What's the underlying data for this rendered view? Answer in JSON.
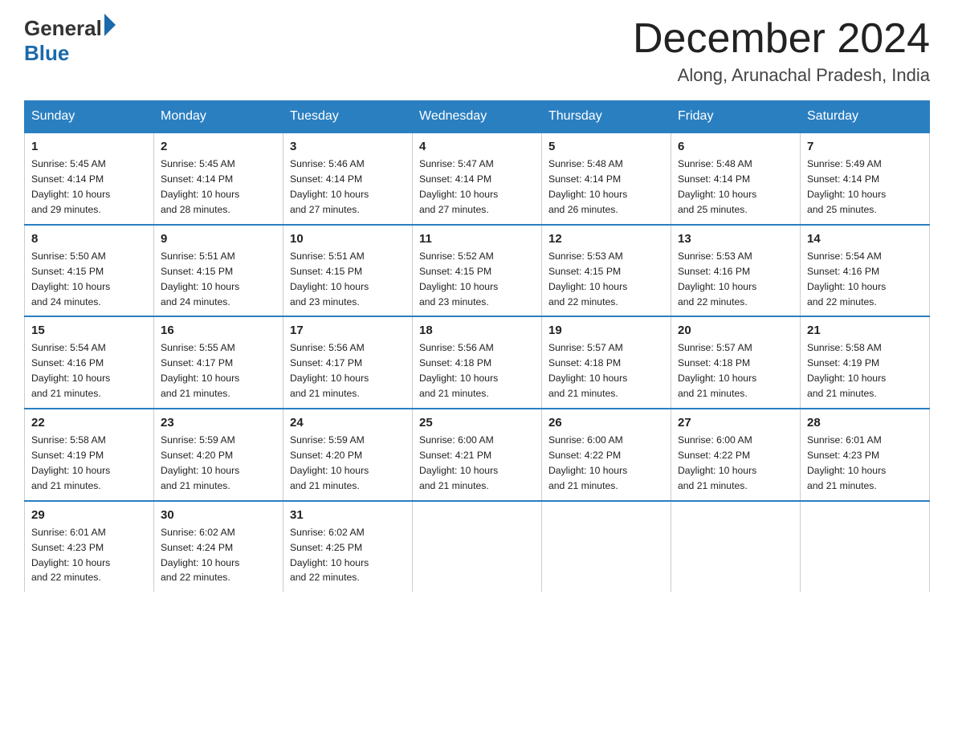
{
  "header": {
    "logo_general": "General",
    "logo_blue": "Blue",
    "month_title": "December 2024",
    "location": "Along, Arunachal Pradesh, India"
  },
  "days_of_week": [
    "Sunday",
    "Monday",
    "Tuesday",
    "Wednesday",
    "Thursday",
    "Friday",
    "Saturday"
  ],
  "weeks": [
    [
      {
        "day": "1",
        "sunrise": "5:45 AM",
        "sunset": "4:14 PM",
        "daylight": "10 hours and 29 minutes."
      },
      {
        "day": "2",
        "sunrise": "5:45 AM",
        "sunset": "4:14 PM",
        "daylight": "10 hours and 28 minutes."
      },
      {
        "day": "3",
        "sunrise": "5:46 AM",
        "sunset": "4:14 PM",
        "daylight": "10 hours and 27 minutes."
      },
      {
        "day": "4",
        "sunrise": "5:47 AM",
        "sunset": "4:14 PM",
        "daylight": "10 hours and 27 minutes."
      },
      {
        "day": "5",
        "sunrise": "5:48 AM",
        "sunset": "4:14 PM",
        "daylight": "10 hours and 26 minutes."
      },
      {
        "day": "6",
        "sunrise": "5:48 AM",
        "sunset": "4:14 PM",
        "daylight": "10 hours and 25 minutes."
      },
      {
        "day": "7",
        "sunrise": "5:49 AM",
        "sunset": "4:14 PM",
        "daylight": "10 hours and 25 minutes."
      }
    ],
    [
      {
        "day": "8",
        "sunrise": "5:50 AM",
        "sunset": "4:15 PM",
        "daylight": "10 hours and 24 minutes."
      },
      {
        "day": "9",
        "sunrise": "5:51 AM",
        "sunset": "4:15 PM",
        "daylight": "10 hours and 24 minutes."
      },
      {
        "day": "10",
        "sunrise": "5:51 AM",
        "sunset": "4:15 PM",
        "daylight": "10 hours and 23 minutes."
      },
      {
        "day": "11",
        "sunrise": "5:52 AM",
        "sunset": "4:15 PM",
        "daylight": "10 hours and 23 minutes."
      },
      {
        "day": "12",
        "sunrise": "5:53 AM",
        "sunset": "4:15 PM",
        "daylight": "10 hours and 22 minutes."
      },
      {
        "day": "13",
        "sunrise": "5:53 AM",
        "sunset": "4:16 PM",
        "daylight": "10 hours and 22 minutes."
      },
      {
        "day": "14",
        "sunrise": "5:54 AM",
        "sunset": "4:16 PM",
        "daylight": "10 hours and 22 minutes."
      }
    ],
    [
      {
        "day": "15",
        "sunrise": "5:54 AM",
        "sunset": "4:16 PM",
        "daylight": "10 hours and 21 minutes."
      },
      {
        "day": "16",
        "sunrise": "5:55 AM",
        "sunset": "4:17 PM",
        "daylight": "10 hours and 21 minutes."
      },
      {
        "day": "17",
        "sunrise": "5:56 AM",
        "sunset": "4:17 PM",
        "daylight": "10 hours and 21 minutes."
      },
      {
        "day": "18",
        "sunrise": "5:56 AM",
        "sunset": "4:18 PM",
        "daylight": "10 hours and 21 minutes."
      },
      {
        "day": "19",
        "sunrise": "5:57 AM",
        "sunset": "4:18 PM",
        "daylight": "10 hours and 21 minutes."
      },
      {
        "day": "20",
        "sunrise": "5:57 AM",
        "sunset": "4:18 PM",
        "daylight": "10 hours and 21 minutes."
      },
      {
        "day": "21",
        "sunrise": "5:58 AM",
        "sunset": "4:19 PM",
        "daylight": "10 hours and 21 minutes."
      }
    ],
    [
      {
        "day": "22",
        "sunrise": "5:58 AM",
        "sunset": "4:19 PM",
        "daylight": "10 hours and 21 minutes."
      },
      {
        "day": "23",
        "sunrise": "5:59 AM",
        "sunset": "4:20 PM",
        "daylight": "10 hours and 21 minutes."
      },
      {
        "day": "24",
        "sunrise": "5:59 AM",
        "sunset": "4:20 PM",
        "daylight": "10 hours and 21 minutes."
      },
      {
        "day": "25",
        "sunrise": "6:00 AM",
        "sunset": "4:21 PM",
        "daylight": "10 hours and 21 minutes."
      },
      {
        "day": "26",
        "sunrise": "6:00 AM",
        "sunset": "4:22 PM",
        "daylight": "10 hours and 21 minutes."
      },
      {
        "day": "27",
        "sunrise": "6:00 AM",
        "sunset": "4:22 PM",
        "daylight": "10 hours and 21 minutes."
      },
      {
        "day": "28",
        "sunrise": "6:01 AM",
        "sunset": "4:23 PM",
        "daylight": "10 hours and 21 minutes."
      }
    ],
    [
      {
        "day": "29",
        "sunrise": "6:01 AM",
        "sunset": "4:23 PM",
        "daylight": "10 hours and 22 minutes."
      },
      {
        "day": "30",
        "sunrise": "6:02 AM",
        "sunset": "4:24 PM",
        "daylight": "10 hours and 22 minutes."
      },
      {
        "day": "31",
        "sunrise": "6:02 AM",
        "sunset": "4:25 PM",
        "daylight": "10 hours and 22 minutes."
      },
      null,
      null,
      null,
      null
    ]
  ],
  "labels": {
    "sunrise": "Sunrise: ",
    "sunset": "Sunset: ",
    "daylight": "Daylight: "
  }
}
